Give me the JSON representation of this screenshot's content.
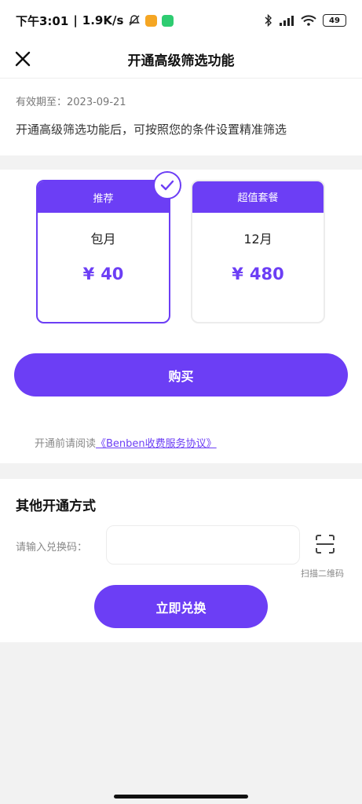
{
  "status_bar": {
    "time": "下午3:01",
    "network_speed": "1.9K/s",
    "separator": "|",
    "battery": "49"
  },
  "header": {
    "title": "开通高级筛选功能"
  },
  "info": {
    "expiry_label": "有效期至：",
    "expiry_date": "2023-09-21",
    "description": "开通高级筛选功能后，可按照您的条件设置精准筛选"
  },
  "plans": [
    {
      "tag": "推荐",
      "name": "包月",
      "currency": "¥",
      "price": "40",
      "selected": true
    },
    {
      "tag": "超值套餐",
      "name": "12月",
      "currency": "¥",
      "price": "480",
      "selected": false
    }
  ],
  "buy_label": "购买",
  "agreement": {
    "prefix": "开通前请阅读",
    "link": "《Benben收费服务协议》"
  },
  "other": {
    "title": "其他开通方式",
    "code_label": "请输入兑换码：",
    "code_value": "",
    "scan_label": "扫描二维码",
    "redeem_label": "立即兑换"
  },
  "colors": {
    "accent": "#6c3ef5",
    "page_bg": "#f2f2f2"
  },
  "icons": {
    "close": "close-icon",
    "check": "check-icon",
    "scan": "scan-icon"
  }
}
